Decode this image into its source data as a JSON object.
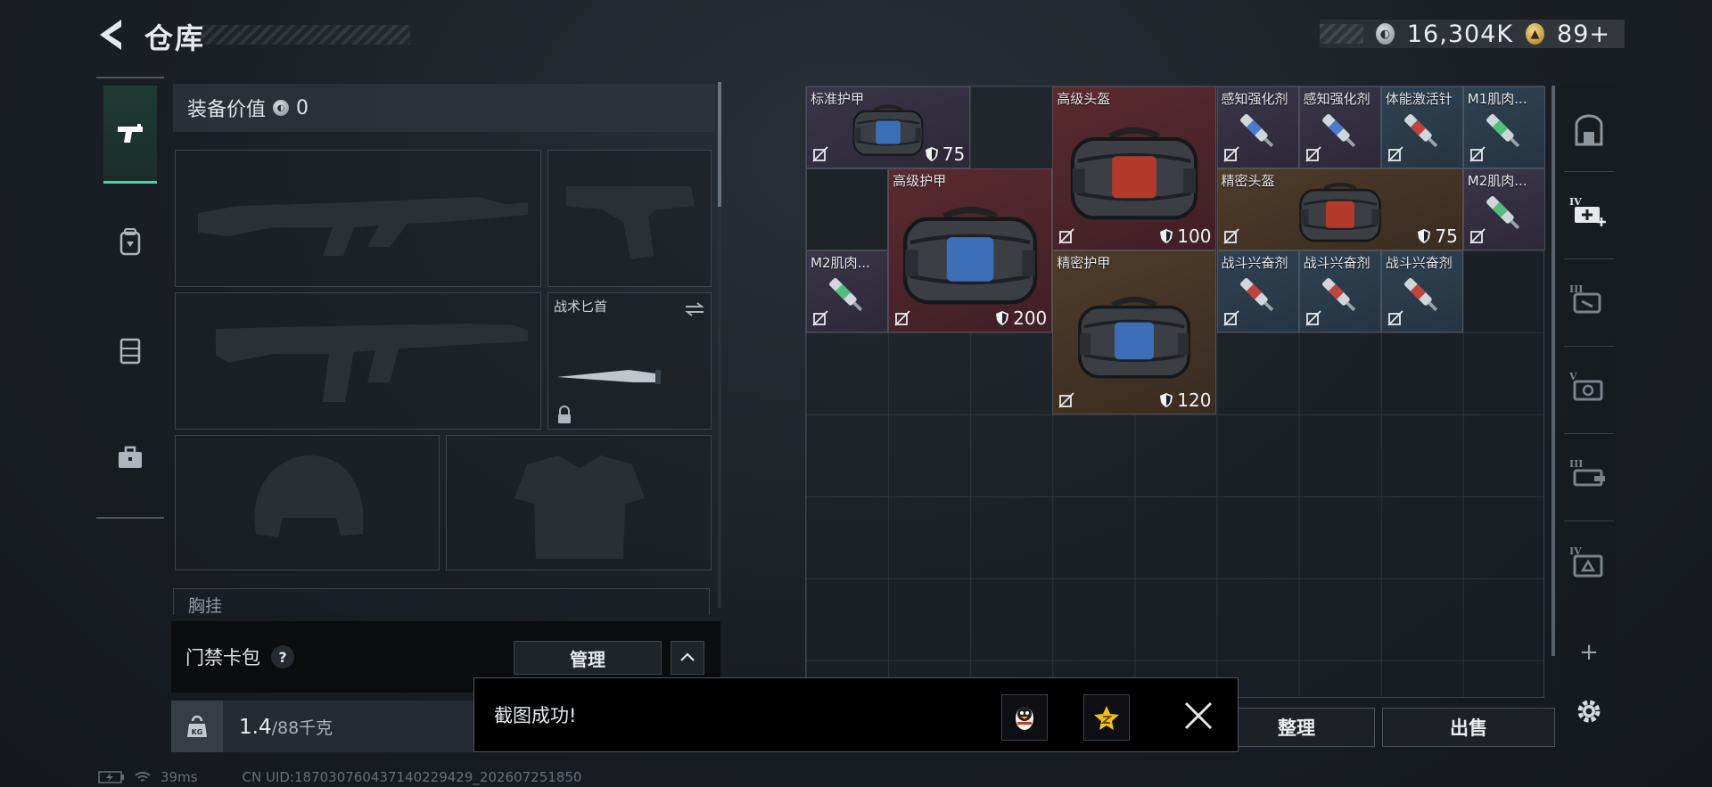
{
  "header": {
    "title": "仓库",
    "currency_silver": "16,304K",
    "currency_gold": "89+"
  },
  "left_nav": [
    {
      "icon": "pistol-icon",
      "active": true
    },
    {
      "icon": "backpack-icon",
      "active": false
    },
    {
      "icon": "vest-icon",
      "active": false
    },
    {
      "icon": "briefcase-icon",
      "active": false
    }
  ],
  "equipment": {
    "value_label": "装备价值",
    "value": "0",
    "melee_label": "战术匕首",
    "partial_label": "胸挂"
  },
  "access_card": {
    "label": "门禁卡包",
    "help": "?",
    "manage_label": "管理"
  },
  "weight": {
    "icon_text": "KG",
    "current": "1.4",
    "max": "/88千克"
  },
  "items": [
    {
      "name": "标准护甲",
      "armor": "75",
      "rarity": "blue"
    },
    {
      "name": "高级头盔",
      "armor": "100",
      "rarity": "red"
    },
    {
      "name": "感知强化剂",
      "rarity": "purple"
    },
    {
      "name": "感知强化剂",
      "rarity": "purple"
    },
    {
      "name": "体能激活针",
      "rarity": "teal"
    },
    {
      "name": "M1肌肉...",
      "rarity": "teal"
    },
    {
      "name": "高级护甲",
      "armor": "200",
      "rarity": "red"
    },
    {
      "name": "精密头盔",
      "armor": "75",
      "rarity": "orange"
    },
    {
      "name": "M2肌肉...",
      "rarity": "purple"
    },
    {
      "name": "M2肌肉...",
      "rarity": "purple"
    },
    {
      "name": "精密护甲",
      "armor": "120",
      "rarity": "orange"
    },
    {
      "name": "战斗兴奋剂",
      "rarity": "teal"
    },
    {
      "name": "战斗兴奋剂",
      "rarity": "teal"
    },
    {
      "name": "战斗兴奋剂",
      "rarity": "teal"
    }
  ],
  "right_nav": {
    "plus_label": "+",
    "tiers": [
      "IV",
      "III",
      "V",
      "III",
      "IV"
    ]
  },
  "actions": {
    "sort_label": "整理",
    "sell_label": "出售"
  },
  "toast": {
    "message": "截图成功!"
  },
  "status": {
    "ping": "39ms",
    "uid": "CN UID:18703076043714022942​9_202607251850"
  },
  "colors": {
    "accent": "#3fd8a5",
    "rarity_red": "#5a2a30",
    "rarity_orange": "#4e3b2a",
    "rarity_purple": "#3a3548",
    "rarity_teal": "#2f4252",
    "rarity_blue": "#3a4154"
  }
}
